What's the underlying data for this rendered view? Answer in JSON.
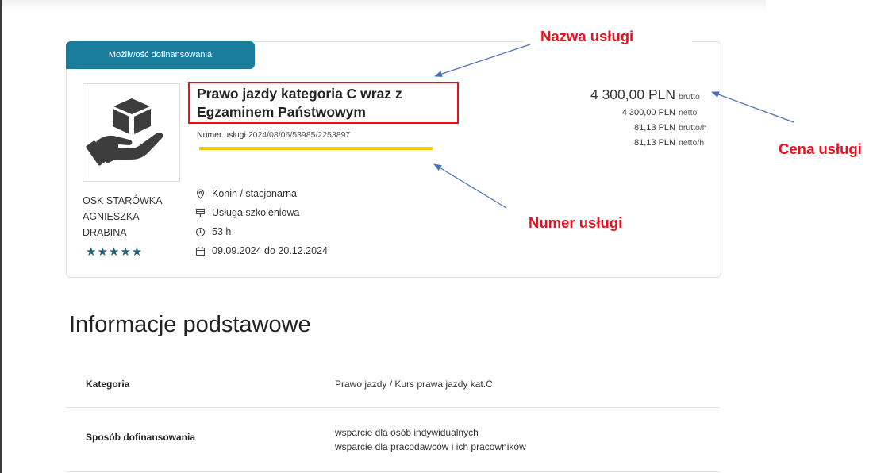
{
  "badge": "Możliwość dofinansowania",
  "service": {
    "title_line1": "Prawo jazdy kategoria C wraz z",
    "title_line2": "Egzaminem Państwowym",
    "number_label": "Numer usługi",
    "number_value": "2024/08/06/53985/2253897"
  },
  "provider": {
    "line1": "OSK STARÓWKA",
    "line2": "AGNIESZKA",
    "line3": "DRABINA",
    "stars": "★★★★★",
    "rating": 5
  },
  "details": {
    "location": "Konin / stacjonarna",
    "type": "Usługa szkoleniowa",
    "hours": "53 h",
    "dates": "09.09.2024 do 20.12.2024"
  },
  "price": {
    "gross": "4 300,00 PLN",
    "gross_label": "brutto",
    "net": "4 300,00 PLN",
    "net_label": "netto",
    "gross_h": "81,13 PLN",
    "gross_h_label": "brutto/h",
    "net_h": "81,13 PLN",
    "net_h_label": "netto/h"
  },
  "annotations": {
    "name": "Nazwa usługi",
    "price": "Cena usługi",
    "number": "Numer usługi"
  },
  "section_title": "Informacje podstawowe",
  "info": [
    {
      "key": "Kategoria",
      "value1": "Prawo jazdy / Kurs prawa jazdy kat.C",
      "value2": ""
    },
    {
      "key": "Sposób dofinansowania",
      "value1": "wsparcie dla osób indywidualnych",
      "value2": "wsparcie dla pracodawców i ich pracowników"
    }
  ],
  "colors": {
    "accent": "#1b7d9c",
    "annotation": "#e8101d",
    "underline": "#f5c70e",
    "arrow": "#4a6fb5"
  }
}
